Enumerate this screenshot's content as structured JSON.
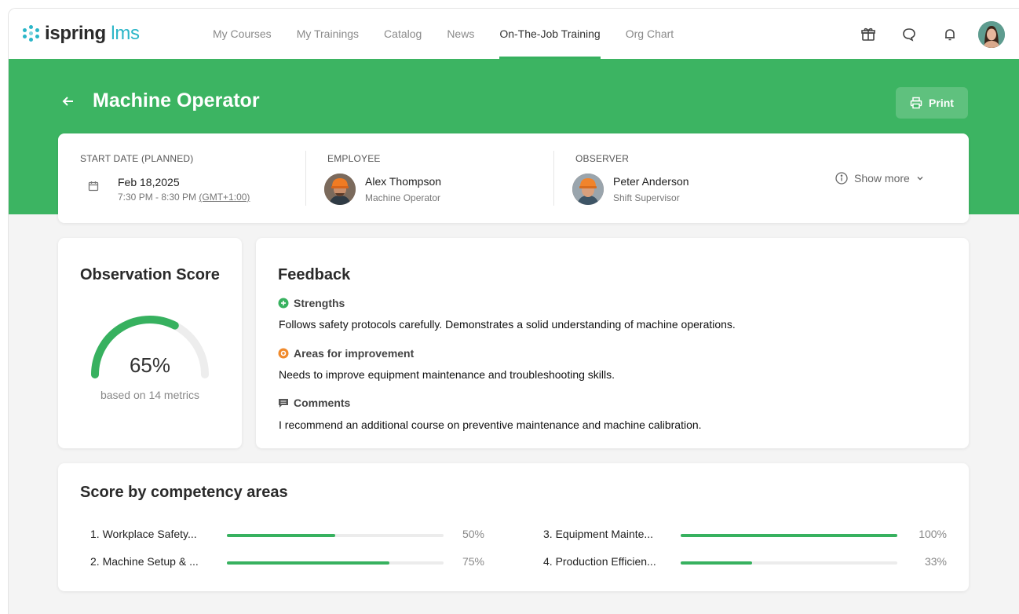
{
  "app": {
    "logo_brand": "ispring",
    "logo_suffix": "lms"
  },
  "nav": {
    "items": [
      {
        "label": "My Courses",
        "active": false
      },
      {
        "label": "My Trainings",
        "active": false
      },
      {
        "label": "Catalog",
        "active": false
      },
      {
        "label": "News",
        "active": false
      },
      {
        "label": "On-The-Job Training",
        "active": true
      },
      {
        "label": "Org Chart",
        "active": false
      }
    ],
    "icons": [
      "gift-icon",
      "chat-icon",
      "bell-icon",
      "user-avatar"
    ]
  },
  "header": {
    "title": "Machine Operator",
    "print_label": "Print"
  },
  "info": {
    "start_date_label": "START DATE (PLANNED)",
    "date": "Feb 18,2025",
    "time_range": "7:30 PM - 8:30 PM",
    "timezone": "(GMT+1:00)",
    "employee_label": "EMPLOYEE",
    "employee_name": "Alex Thompson",
    "employee_role": "Machine Operator",
    "observer_label": "OBSERVER",
    "observer_name": "Peter Anderson",
    "observer_role": "Shift Supervisor",
    "show_more": "Show more"
  },
  "score": {
    "title": "Observation Score",
    "value_text": "65%",
    "value": 0.65,
    "subtitle": "based on 14 metrics"
  },
  "feedback": {
    "title": "Feedback",
    "strengths_label": "Strengths",
    "strengths_text": "Follows safety protocols carefully. Demonstrates a solid understanding of machine operations.",
    "improvement_label": "Areas for improvement",
    "improvement_text": "Needs to improve equipment maintenance and troubleshooting skills.",
    "comments_label": "Comments",
    "comments_text": "I recommend an additional course on preventive maintenance and machine calibration."
  },
  "competency": {
    "title": "Score by competency areas",
    "items": [
      {
        "label": "1. Workplace Safety...",
        "pct_text": "50%",
        "value": 0.5
      },
      {
        "label": "2. Machine Setup & ...",
        "pct_text": "75%",
        "value": 0.75
      },
      {
        "label": "3. Equipment Mainte...",
        "pct_text": "100%",
        "value": 1.0
      },
      {
        "label": "4. Production Efficien...",
        "pct_text": "33%",
        "value": 0.33
      }
    ]
  },
  "colors": {
    "brand_green": "#3cb462",
    "accent_teal": "#2bb6c8",
    "improvement_orange": "#f08a2c"
  }
}
